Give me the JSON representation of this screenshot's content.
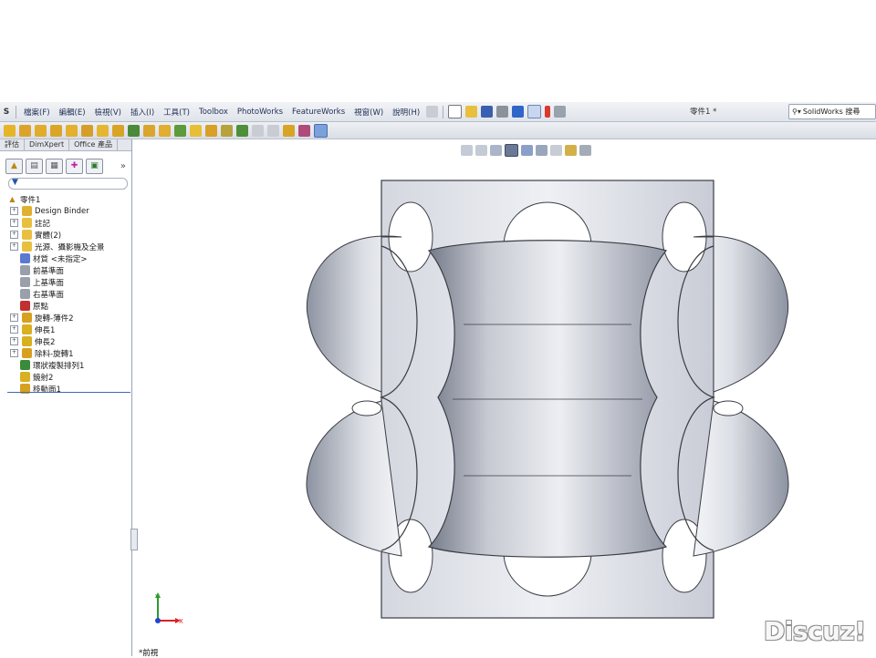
{
  "app_initial": "S",
  "menu": [
    {
      "id": "file",
      "label": "檔案(F)"
    },
    {
      "id": "edit",
      "label": "編輯(E)"
    },
    {
      "id": "view",
      "label": "檢視(V)"
    },
    {
      "id": "insert",
      "label": "插入(I)"
    },
    {
      "id": "tools",
      "label": "工具(T)"
    },
    {
      "id": "toolbox",
      "label": "Toolbox"
    },
    {
      "id": "photoworks",
      "label": "PhotoWorks"
    },
    {
      "id": "featureworks",
      "label": "FeatureWorks"
    },
    {
      "id": "window",
      "label": "視窗(W)"
    },
    {
      "id": "help",
      "label": "說明(H)"
    }
  ],
  "document_title": "零件1 *",
  "search": {
    "label": "SolidWorks 搜尋"
  },
  "command_manager_tabs": [
    "評估",
    "DimXpert",
    "Office 產品"
  ],
  "feature_tree": {
    "root": "零件1",
    "items": [
      {
        "label": "Design Binder",
        "expand": true,
        "icon": "binder-icon",
        "color": "#e0b030"
      },
      {
        "label": "註記",
        "expand": true,
        "icon": "annotation-icon",
        "color": "#e8c040"
      },
      {
        "label": "實體(2)",
        "expand": true,
        "icon": "solid-bodies-icon",
        "color": "#e8c040"
      },
      {
        "label": "光源、攝影機及全景",
        "expand": true,
        "icon": "lights-icon",
        "color": "#e8c040"
      },
      {
        "label": "材質 <未指定>",
        "expand": false,
        "icon": "material-icon",
        "color": "#5a7ad0"
      },
      {
        "label": "前基準面",
        "expand": false,
        "icon": "plane-icon",
        "color": "#9aa0aa"
      },
      {
        "label": "上基準面",
        "expand": false,
        "icon": "plane-icon",
        "color": "#9aa0aa"
      },
      {
        "label": "右基準面",
        "expand": false,
        "icon": "plane-icon",
        "color": "#9aa0aa"
      },
      {
        "label": "原點",
        "expand": false,
        "icon": "origin-icon",
        "color": "#c23030"
      },
      {
        "label": "旋轉-薄件2",
        "expand": true,
        "icon": "revolve-thin-icon",
        "color": "#d8a020"
      },
      {
        "label": "伸長1",
        "expand": true,
        "icon": "extrude-icon",
        "color": "#d8b020"
      },
      {
        "label": "伸長2",
        "expand": true,
        "icon": "extrude-icon",
        "color": "#d8b020"
      },
      {
        "label": "除料-旋轉1",
        "expand": true,
        "icon": "revolve-cut-icon",
        "color": "#d8a020"
      },
      {
        "label": "環狀複製排列1",
        "expand": false,
        "icon": "circular-pattern-icon",
        "color": "#3a8a3a"
      },
      {
        "label": "鏡射2",
        "expand": false,
        "icon": "mirror-icon",
        "color": "#d8b020"
      },
      {
        "label": "移動面1",
        "expand": false,
        "icon": "move-face-icon",
        "color": "#d8a020"
      }
    ]
  },
  "triad": {
    "x": "X",
    "y": "Y"
  },
  "view_name": "*前視",
  "watermark": "Discuz!"
}
